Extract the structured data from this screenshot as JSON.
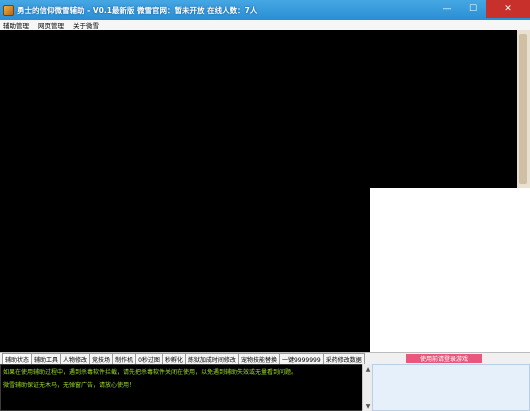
{
  "window": {
    "title": "勇士的信仰微雪辅助 - V0.1最新版 微雪官网：暂未开放 在线人数：7人",
    "minimize": "—",
    "maximize": "☐",
    "close": "✕"
  },
  "menu": {
    "items": [
      "辅助管理",
      "网页管理",
      "关于微雪"
    ]
  },
  "tabs": [
    "辅助状态",
    "辅助工具",
    "人物修改",
    "竞技场",
    "制作机",
    "0秒过图",
    "秒孵化",
    "炼狱加成时间修改",
    "宠物技能替换",
    "一键9999999",
    "采药修改数据"
  ],
  "pink_button": "使用前请登录游戏",
  "log": {
    "lines": [
      "如果在使用辅助过程中，遇到杀毒软件拦截，请先把杀毒软件关闭在使用，以免遇到辅助失效或无量看到问题。",
      "微雪辅助保证无木马，无弹窗广告，请放心使用！"
    ]
  },
  "colors": {
    "titlebar": "#2a8ed4",
    "close_button": "#c7302b",
    "log_text": "#9ddf2d",
    "pink_button": "#e9577c"
  }
}
